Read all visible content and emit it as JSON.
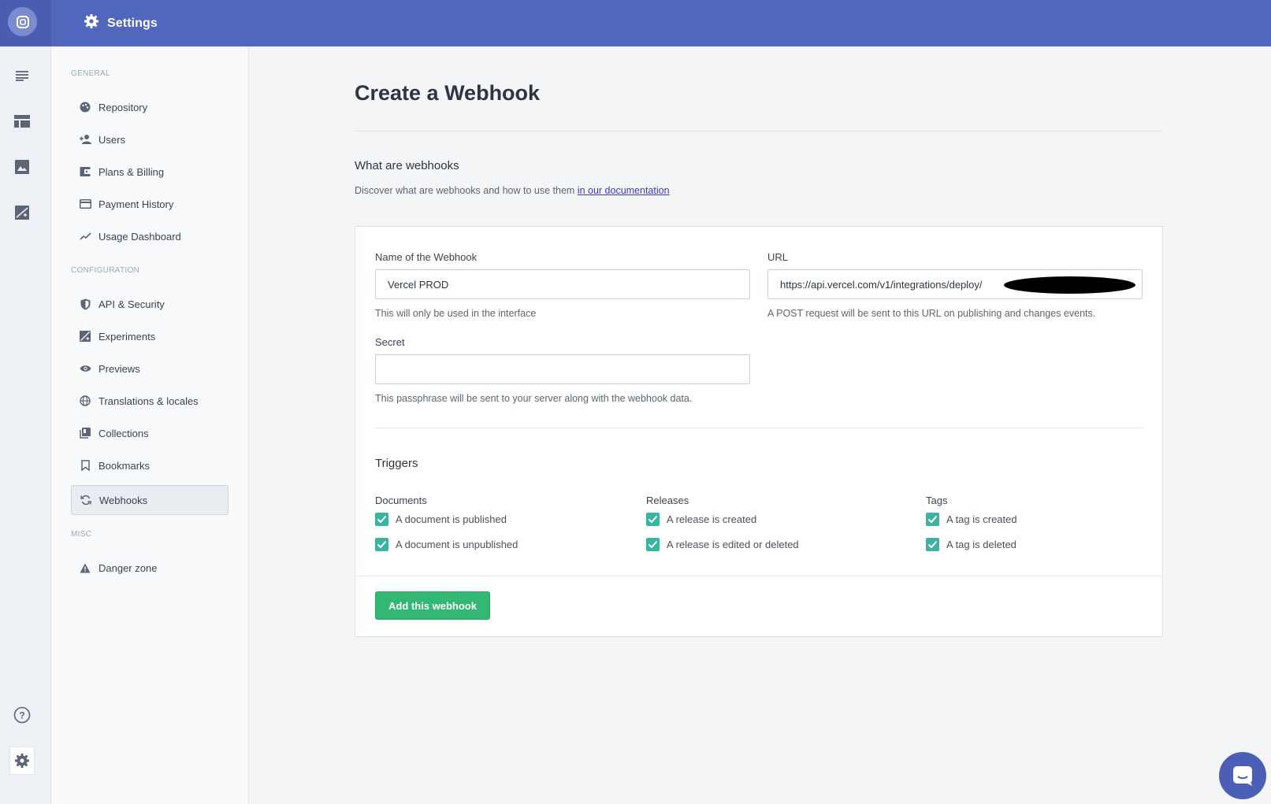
{
  "header": {
    "title": "Settings"
  },
  "sidebar": {
    "sections": [
      {
        "label": "GENERAL"
      },
      {
        "label": "CONFIGURATION"
      },
      {
        "label": "MISC"
      }
    ],
    "items": [
      {
        "label": "Repository",
        "icon": "palette-icon"
      },
      {
        "label": "Users",
        "icon": "add-user-icon"
      },
      {
        "label": "Plans & Billing",
        "icon": "wallet-icon"
      },
      {
        "label": "Payment History",
        "icon": "credit-card-icon"
      },
      {
        "label": "Usage Dashboard",
        "icon": "trend-line-icon"
      },
      {
        "label": "API & Security",
        "icon": "shield-icon"
      },
      {
        "label": "Experiments",
        "icon": "experiment-icon"
      },
      {
        "label": "Previews",
        "icon": "eye-icon"
      },
      {
        "label": "Translations & locales",
        "icon": "globe-icon"
      },
      {
        "label": "Collections",
        "icon": "collections-icon"
      },
      {
        "label": "Bookmarks",
        "icon": "bookmark-icon"
      },
      {
        "label": "Webhooks",
        "icon": "refresh-icon",
        "active": true
      },
      {
        "label": "Danger zone",
        "icon": "warning-icon"
      }
    ]
  },
  "main": {
    "title": "Create a Webhook",
    "intro": {
      "heading": "What are webhooks",
      "text": "Discover what are webhooks and how to use them ",
      "link": "in our documentation"
    },
    "form": {
      "name_label": "Name of the Webhook",
      "name_value": "Vercel PROD",
      "name_help": "This will only be used in the interface",
      "url_label": "URL",
      "url_value": "https://api.vercel.com/v1/integrations/deploy/",
      "url_help": "A POST request will be sent to this URL on publishing and changes events.",
      "secret_label": "Secret",
      "secret_value": "",
      "secret_help": "This passphrase will be sent to your server along with the webhook data."
    },
    "triggers": {
      "title": "Triggers",
      "groups": [
        {
          "title": "Documents",
          "items": [
            "A document is published",
            "A document is unpublished"
          ]
        },
        {
          "title": "Releases",
          "items": [
            "A release is created",
            "A release is edited or deleted"
          ]
        },
        {
          "title": "Tags",
          "items": [
            "A tag is created",
            "A tag is deleted"
          ]
        }
      ]
    },
    "submit_label": "Add this webhook"
  },
  "colors": {
    "topbar": "#5166bd",
    "accent_checkbox": "#3bb3a0",
    "button_green": "#33b873"
  }
}
